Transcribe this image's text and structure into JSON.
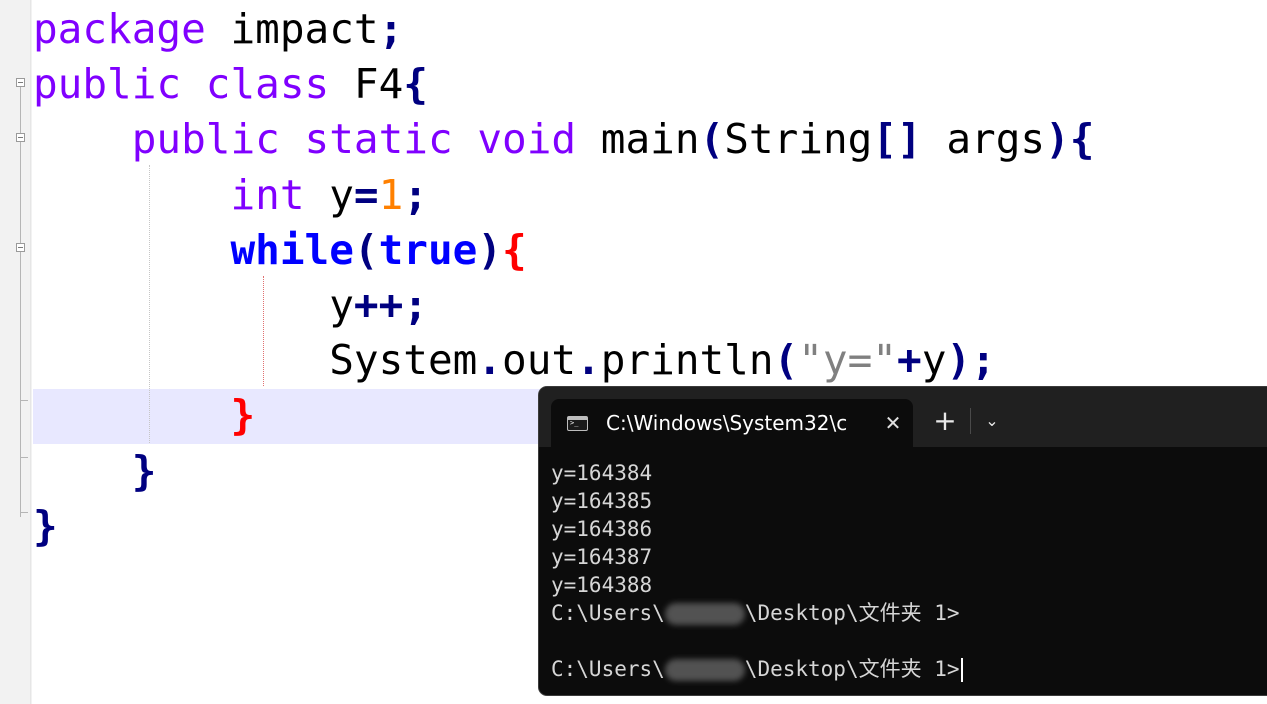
{
  "editor": {
    "lines": [
      [
        {
          "t": "package",
          "c": "kw"
        },
        {
          "t": " impact",
          "c": "txt"
        },
        {
          "t": ";",
          "c": "op"
        }
      ],
      [
        {
          "t": "public",
          "c": "kw"
        },
        {
          "t": " ",
          "c": "txt"
        },
        {
          "t": "class",
          "c": "kw"
        },
        {
          "t": " F4",
          "c": "txt"
        },
        {
          "t": "{",
          "c": "brace"
        }
      ],
      [
        {
          "t": "    ",
          "c": "txt"
        },
        {
          "t": "public",
          "c": "kw"
        },
        {
          "t": " ",
          "c": "txt"
        },
        {
          "t": "static",
          "c": "kw"
        },
        {
          "t": " ",
          "c": "txt"
        },
        {
          "t": "void",
          "c": "kw"
        },
        {
          "t": " main",
          "c": "txt"
        },
        {
          "t": "(",
          "c": "op"
        },
        {
          "t": "String",
          "c": "txt"
        },
        {
          "t": "[]",
          "c": "op"
        },
        {
          "t": " args",
          "c": "txt"
        },
        {
          "t": "){",
          "c": "op"
        }
      ],
      [
        {
          "t": "        ",
          "c": "txt"
        },
        {
          "t": "int",
          "c": "kw"
        },
        {
          "t": " y",
          "c": "txt"
        },
        {
          "t": "=",
          "c": "op"
        },
        {
          "t": "1",
          "c": "num"
        },
        {
          "t": ";",
          "c": "op"
        }
      ],
      [
        {
          "t": "        ",
          "c": "txt"
        },
        {
          "t": "while",
          "c": "kw-b"
        },
        {
          "t": "(",
          "c": "op"
        },
        {
          "t": "true",
          "c": "kw-b"
        },
        {
          "t": ")",
          "c": "op"
        },
        {
          "t": "{",
          "c": "brace-red"
        }
      ],
      [
        {
          "t": "            y",
          "c": "txt"
        },
        {
          "t": "++;",
          "c": "op"
        }
      ],
      [
        {
          "t": "            System",
          "c": "txt"
        },
        {
          "t": ".",
          "c": "op"
        },
        {
          "t": "out",
          "c": "txt"
        },
        {
          "t": ".",
          "c": "op"
        },
        {
          "t": "println",
          "c": "txt"
        },
        {
          "t": "(",
          "c": "op"
        },
        {
          "t": "\"y=\"",
          "c": "str"
        },
        {
          "t": "+",
          "c": "op"
        },
        {
          "t": "y",
          "c": "txt"
        },
        {
          "t": ");",
          "c": "op"
        }
      ],
      [
        {
          "t": "        ",
          "c": "txt"
        },
        {
          "t": "}",
          "c": "brace-red"
        }
      ],
      [
        {
          "t": "    ",
          "c": "txt"
        },
        {
          "t": "}",
          "c": "brace"
        }
      ],
      [
        {
          "t": "}",
          "c": "brace"
        }
      ]
    ]
  },
  "terminal": {
    "tab_title": "C:\\Windows\\System32\\c",
    "close_glyph": "✕",
    "new_tab_glyph": "+",
    "dropdown_glyph": "⌄",
    "output": [
      "y=164384",
      "y=164385",
      "y=164386",
      "y=164387",
      "y=164388"
    ],
    "prompt_prefix": "C:\\Users\\",
    "prompt_suffix": "\\Desktop\\文件夹 1>",
    "icons": {
      "tab": "terminal-icon",
      "close": "close-icon",
      "new_tab": "plus-icon",
      "dropdown": "chevron-down-icon"
    }
  }
}
